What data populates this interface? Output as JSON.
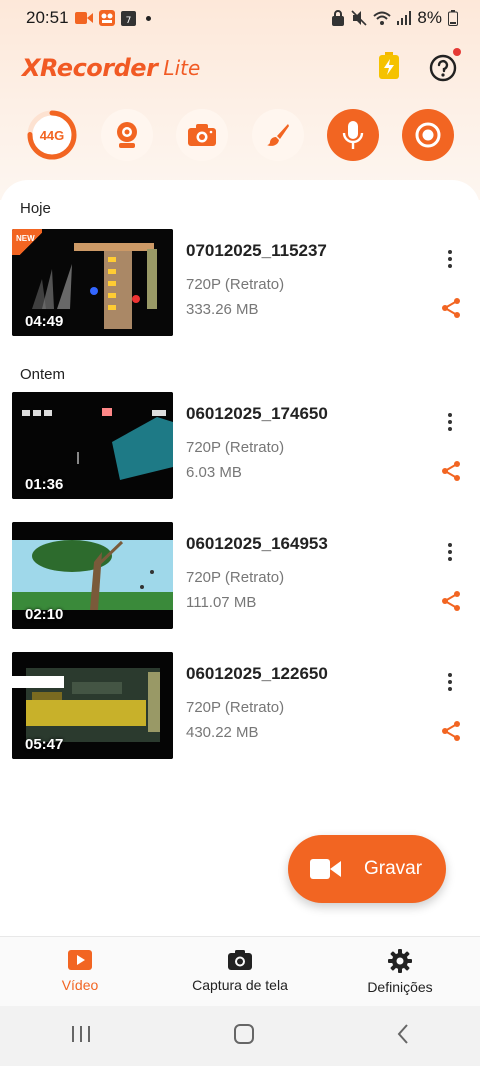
{
  "status_bar": {
    "time": "20:51",
    "battery": "8%"
  },
  "header": {
    "logo": "XRecorder",
    "logo_suffix": "Lite"
  },
  "tools": {
    "storage": "44G"
  },
  "sections": [
    {
      "label": "Hoje",
      "videos": [
        {
          "title": "07012025_115237",
          "resolution": "720P (Retrato)",
          "size": "333.26 MB",
          "duration": "04:49",
          "badge": "NEW"
        }
      ]
    },
    {
      "label": "Ontem",
      "videos": [
        {
          "title": "06012025_174650",
          "resolution": "720P (Retrato)",
          "size": "6.03 MB",
          "duration": "01:36"
        },
        {
          "title": "06012025_164953",
          "resolution": "720P (Retrato)",
          "size": "111.07 MB",
          "duration": "02:10"
        },
        {
          "title": "06012025_122650",
          "resolution": "720P (Retrato)",
          "size": "430.22 MB",
          "duration": "05:47"
        }
      ]
    }
  ],
  "fab": {
    "label": "Gravar"
  },
  "bottom_nav": [
    {
      "label": "Vídeo",
      "icon": "play-icon",
      "active": true
    },
    {
      "label": "Captura de tela",
      "icon": "camera-icon",
      "active": false
    },
    {
      "label": "Definições",
      "icon": "gear-icon",
      "active": false
    }
  ],
  "colors": {
    "accent": "#f26522"
  }
}
